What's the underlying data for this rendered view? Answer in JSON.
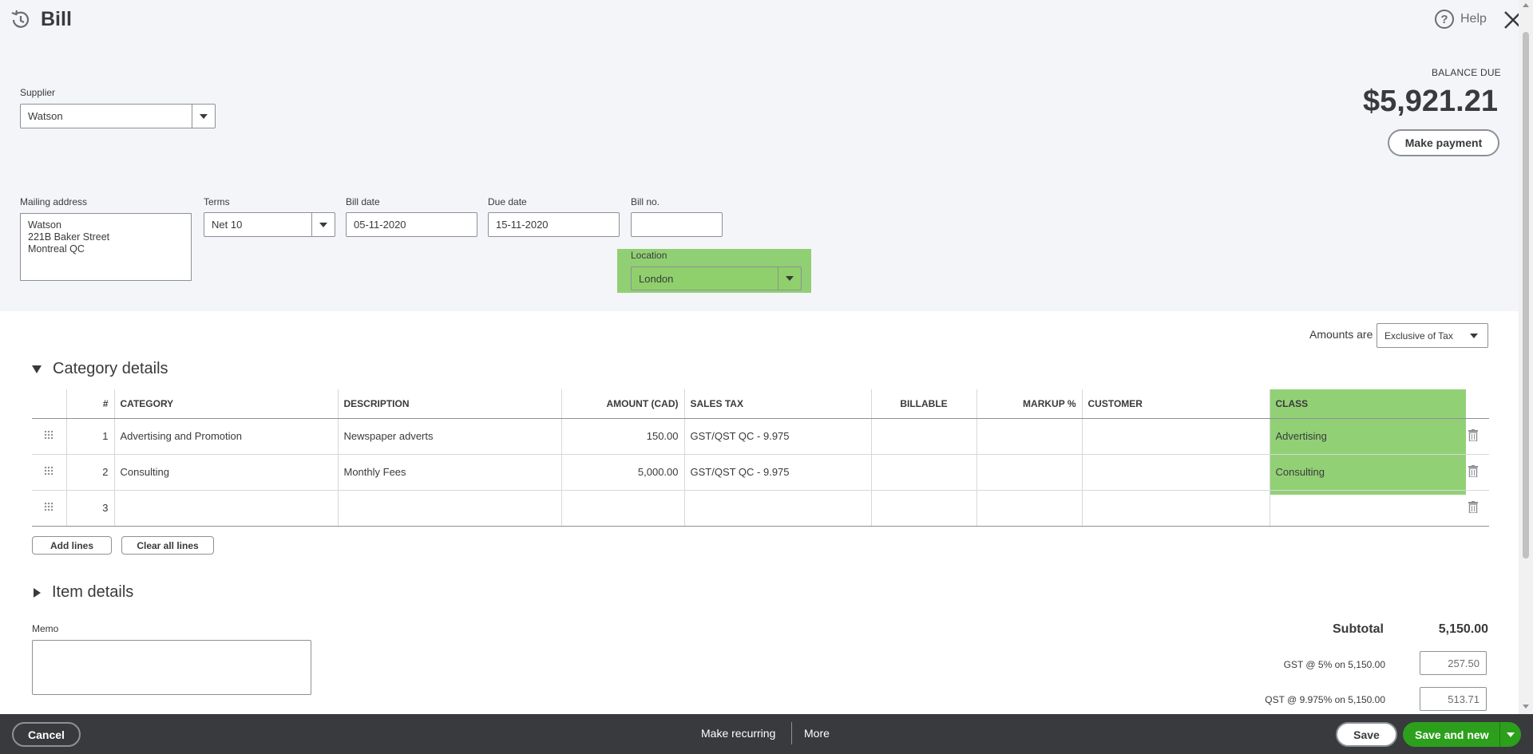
{
  "header": {
    "title": "Bill",
    "help_label": "Help"
  },
  "supplier": {
    "label": "Supplier",
    "value": "Watson"
  },
  "mailing_address": {
    "label": "Mailing address",
    "lines": [
      "Watson",
      "221B Baker Street",
      "Montreal QC"
    ]
  },
  "terms": {
    "label": "Terms",
    "value": "Net 10"
  },
  "bill_date": {
    "label": "Bill date",
    "value": "05-11-2020"
  },
  "due_date": {
    "label": "Due date",
    "value": "15-11-2020"
  },
  "bill_no": {
    "label": "Bill no.",
    "value": ""
  },
  "location": {
    "label": "Location",
    "value": "London"
  },
  "balance": {
    "label": "BALANCE DUE",
    "amount": "$5,921.21",
    "make_payment": "Make payment"
  },
  "amounts_are": {
    "label": "Amounts are",
    "value": "Exclusive of Tax"
  },
  "category_details": {
    "title": "Category details",
    "columns": [
      "#",
      "CATEGORY",
      "DESCRIPTION",
      "AMOUNT (CAD)",
      "SALES TAX",
      "BILLABLE",
      "MARKUP %",
      "CUSTOMER",
      "CLASS"
    ],
    "rows": [
      {
        "num": "1",
        "category": "Advertising and Promotion",
        "description": "Newspaper adverts",
        "amount": "150.00",
        "sales_tax": "GST/QST QC - 9.975",
        "billable": "",
        "markup": "",
        "customer": "",
        "class": "Advertising"
      },
      {
        "num": "2",
        "category": "Consulting",
        "description": "Monthly Fees",
        "amount": "5,000.00",
        "sales_tax": "GST/QST QC - 9.975",
        "billable": "",
        "markup": "",
        "customer": "",
        "class": "Consulting"
      },
      {
        "num": "3",
        "category": "",
        "description": "",
        "amount": "",
        "sales_tax": "",
        "billable": "",
        "markup": "",
        "customer": "",
        "class": ""
      }
    ],
    "add_lines": "Add lines",
    "clear_all_lines": "Clear all lines"
  },
  "item_details": {
    "title": "Item details"
  },
  "memo": {
    "label": "Memo",
    "value": ""
  },
  "totals": {
    "subtotal_label": "Subtotal",
    "subtotal_value": "5,150.00",
    "taxes": [
      {
        "label": "GST @ 5% on 5,150.00",
        "value": "257.50"
      },
      {
        "label": "QST @ 9.975% on 5,150.00",
        "value": "513.71"
      }
    ]
  },
  "footer": {
    "cancel": "Cancel",
    "make_recurring": "Make recurring",
    "more": "More",
    "save": "Save",
    "save_and_new": "Save and new"
  },
  "colors": {
    "highlight": "#7fc85d",
    "primary_green": "#2ca01c",
    "footer_bg": "#393a3d",
    "header_bg": "#f4f5f8"
  }
}
